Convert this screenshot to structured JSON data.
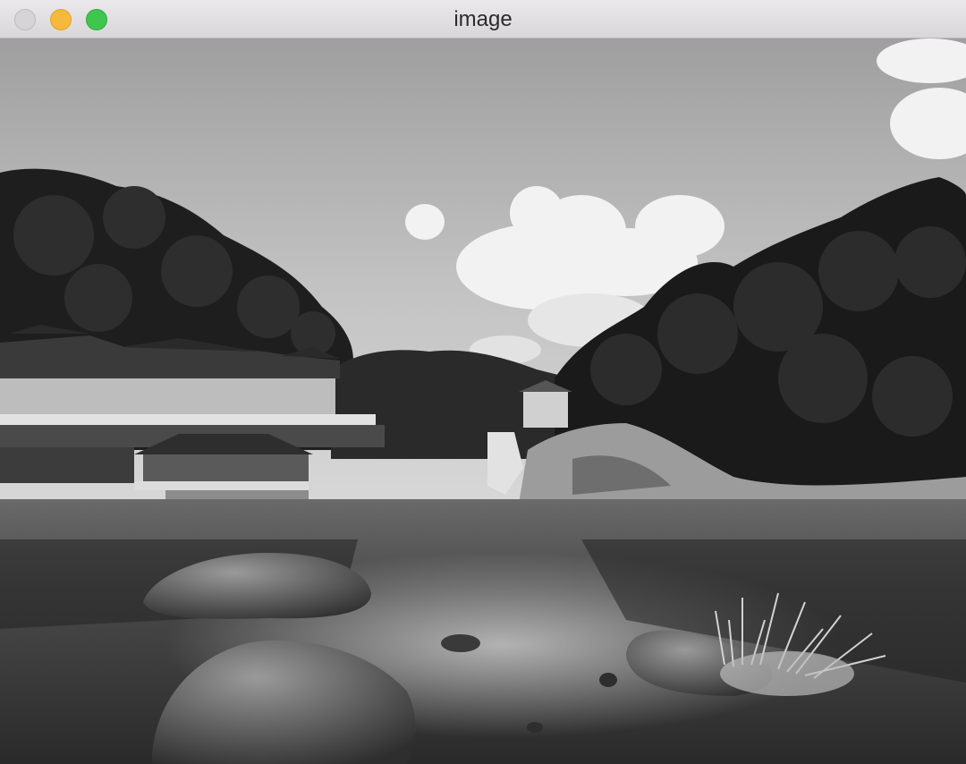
{
  "window": {
    "title": "image",
    "controls": [
      "close-button",
      "minimize-button",
      "zoom-button"
    ]
  },
  "image": {
    "description_kind": "grayscale landscape photograph",
    "colors": {
      "sky_top": "#a4a4a4",
      "sky_bottom": "#d0d0d0",
      "foliage": "#1c1c1c",
      "water": "#3b3b3b"
    }
  }
}
